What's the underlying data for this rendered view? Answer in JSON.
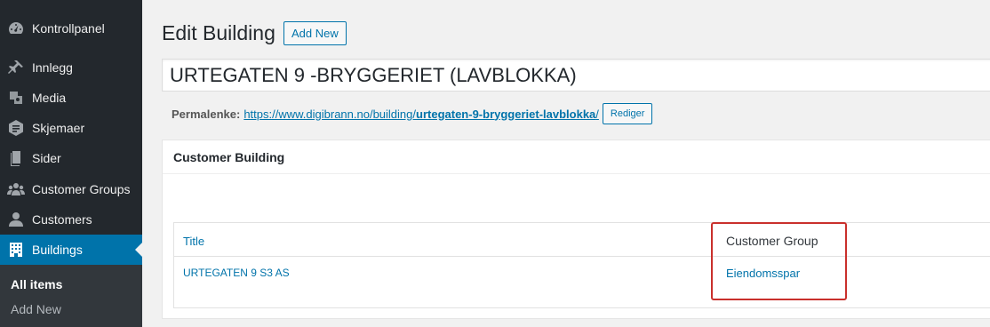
{
  "sidebar": {
    "items": [
      {
        "label": "Kontrollpanel",
        "icon": "dashboard-icon"
      },
      {
        "label": "Innlegg",
        "icon": "pin-icon"
      },
      {
        "label": "Media",
        "icon": "media-icon"
      },
      {
        "label": "Skjemaer",
        "icon": "forms-icon"
      },
      {
        "label": "Sider",
        "icon": "pages-icon"
      },
      {
        "label": "Customer Groups",
        "icon": "groups-icon"
      },
      {
        "label": "Customers",
        "icon": "user-icon"
      },
      {
        "label": "Buildings",
        "icon": "building-icon",
        "active": true
      }
    ],
    "submenu": [
      {
        "label": "All items",
        "current": true
      },
      {
        "label": "Add New"
      }
    ]
  },
  "header": {
    "title": "Edit Building",
    "add_new_label": "Add New"
  },
  "post": {
    "title_value": "URTEGATEN 9 -BRYGGERIET (LAVBLOKKA)",
    "permalink_label": "Permalenke:",
    "permalink_base": "https://www.digibrann.no/building/",
    "permalink_slug": "urtegaten-9-bryggeriet-lavblokka",
    "permalink_trailing": "/",
    "rediger_label": "Rediger"
  },
  "metabox": {
    "title": "Customer Building",
    "columns": [
      "Title",
      "Customer Group"
    ],
    "rows": [
      [
        "URTEGATEN 9 S3 AS",
        "Eiendomsspar"
      ]
    ]
  },
  "colors": {
    "sidebar_bg": "#23282d",
    "accent": "#0073aa",
    "highlight_border": "#c9302c"
  }
}
